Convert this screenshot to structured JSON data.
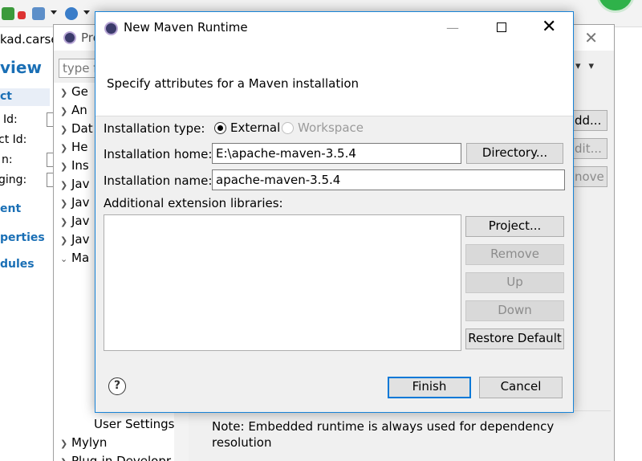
{
  "background_editor": {
    "tab_title": "kad.carse",
    "page_heading": "view",
    "section_artifact": "ct",
    "fields": [
      "Id:",
      "ct Id:",
      "n:",
      "ging:"
    ],
    "section_parent": "ent",
    "section_properties": "perties",
    "section_modules": "dules"
  },
  "preferences": {
    "title": "Pre",
    "filter_placeholder": "type fi",
    "tree": [
      {
        "label": "Ge",
        "expanded": false
      },
      {
        "label": "An",
        "expanded": false
      },
      {
        "label": "Dat",
        "expanded": false
      },
      {
        "label": "He",
        "expanded": false
      },
      {
        "label": "Ins",
        "expanded": false
      },
      {
        "label": "Jav",
        "expanded": false
      },
      {
        "label": "Jav",
        "expanded": false
      },
      {
        "label": "Jav",
        "expanded": false
      },
      {
        "label": "Jav",
        "expanded": false
      },
      {
        "label": "Ma",
        "expanded": true
      }
    ],
    "tree_child": "User Settings",
    "tree_after": [
      {
        "label": "Mylyn"
      },
      {
        "label": "Plug-in Developr"
      }
    ],
    "side_buttons": {
      "add": "dd...",
      "edit": "dit...",
      "remove": "nove"
    },
    "note": "Note: Embedded runtime is always used for dependency resolution"
  },
  "dialog": {
    "title": "New Maven Runtime",
    "message": "Specify attributes for a Maven installation",
    "installation_type_label": "Installation type:",
    "type_external": "External",
    "type_workspace": "Workspace",
    "installation_home_label": "Installation home:",
    "installation_home_value": "E:\\apache-maven-3.5.4",
    "directory_button": "Directory...",
    "installation_name_label": "Installation name:",
    "installation_name_value": "apache-maven-3.5.4",
    "extension_libraries_label": "Additional extension libraries:",
    "buttons": {
      "project": "Project...",
      "remove": "Remove",
      "up": "Up",
      "down": "Down",
      "restore_default": "Restore Default",
      "finish": "Finish",
      "cancel": "Cancel"
    },
    "help_symbol": "?"
  }
}
